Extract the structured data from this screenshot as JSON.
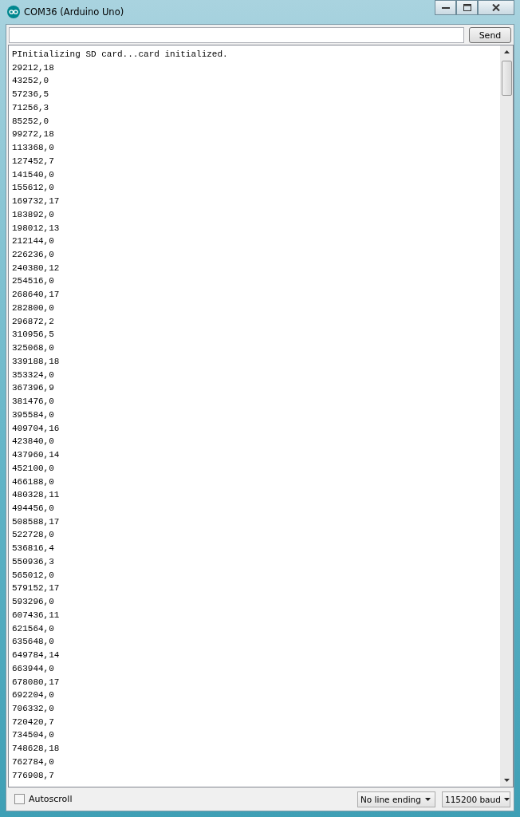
{
  "window": {
    "title": "COM36 (Arduino Uno)"
  },
  "send_button": "Send",
  "output_lines": [
    "PInitializing SD card...card initialized.",
    "29212,18",
    "43252,0",
    "57236,5",
    "71256,3",
    "85252,0",
    "99272,18",
    "113368,0",
    "127452,7",
    "141540,0",
    "155612,0",
    "169732,17",
    "183892,0",
    "198012,13",
    "212144,0",
    "226236,0",
    "240380,12",
    "254516,0",
    "268640,17",
    "282800,0",
    "296872,2",
    "310956,5",
    "325068,0",
    "339188,18",
    "353324,0",
    "367396,9",
    "381476,0",
    "395584,0",
    "409704,16",
    "423840,0",
    "437960,14",
    "452100,0",
    "466188,0",
    "480328,11",
    "494456,0",
    "508588,17",
    "522728,0",
    "536816,4",
    "550936,3",
    "565012,0",
    "579152,17",
    "593296,0",
    "607436,11",
    "621564,0",
    "635648,0",
    "649784,14",
    "663944,0",
    "678080,17",
    "692204,0",
    "706332,0",
    "720420,7",
    "734504,0",
    "748628,18",
    "762784,0",
    "776908,7"
  ],
  "autoscroll": {
    "label": "Autoscroll",
    "checked": false
  },
  "line_ending": {
    "value": "No line ending"
  },
  "baud": {
    "value": "115200 baud"
  }
}
